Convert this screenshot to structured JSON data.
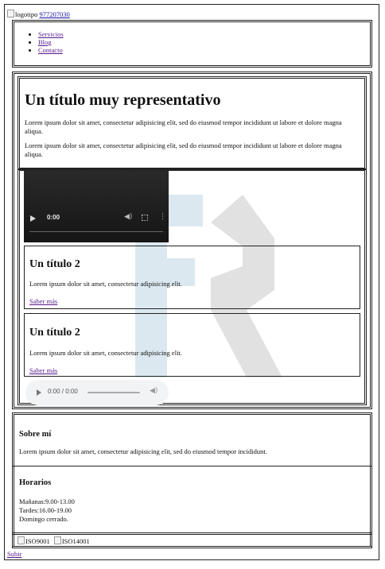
{
  "header": {
    "logo_alt": "logotipo",
    "phone": "977207030",
    "nav": [
      "Servicios",
      "Blog",
      "Contacto"
    ]
  },
  "main": {
    "title": "Un título muy representativo",
    "paragraphs": [
      "Lorem ipsum dolor sit amet, consectetur adipisicing elit, sed do eiusmod tempor incididunt ut labore et dolore magna aliqua.",
      "Lorem ipsum dolor sit amet, consectetur adipisicing elit, sed do eiusmod tempor incididunt ut labore et dolore magna aliqua."
    ],
    "video": {
      "time": "0:00",
      "volume_icon": "volume-icon",
      "fullscreen_icon": "fullscreen-icon",
      "menu_icon": "more-options-icon"
    },
    "cards": [
      {
        "title": "Un título 2",
        "text": "Lorem ipsum dolor sit amet, consectetur adipisicing elit.",
        "link": "Saber más"
      },
      {
        "title": "Un título 2",
        "text": "Lorem ipsum dolor sit amet, consectetur adipisicing elit.",
        "link": "Saber más"
      }
    ],
    "audio": {
      "time": "0:00 / 0:00",
      "play_icon": "play-icon",
      "volume_icon": "volume-icon"
    }
  },
  "aside": {
    "about_title": "Sobre mí",
    "about_text": "Lorem ipsum dolor sit amet, consectetur adipisicing elit, sed do eiusmod tempor incididunt.",
    "hours_title": "Horarios",
    "hours": [
      "Mañanas:9.00-13.00",
      "Tardes:16.00-19.00",
      "Domingo cerrado."
    ]
  },
  "footer": {
    "badges": [
      "ISO9001",
      "ISO14001"
    ],
    "back_to_top": "Subir"
  },
  "colors": {
    "link": "#1a0dab",
    "visited": "#551a8b",
    "watermark_blue": "#c9dde8",
    "watermark_gray": "#d6d6d6"
  }
}
